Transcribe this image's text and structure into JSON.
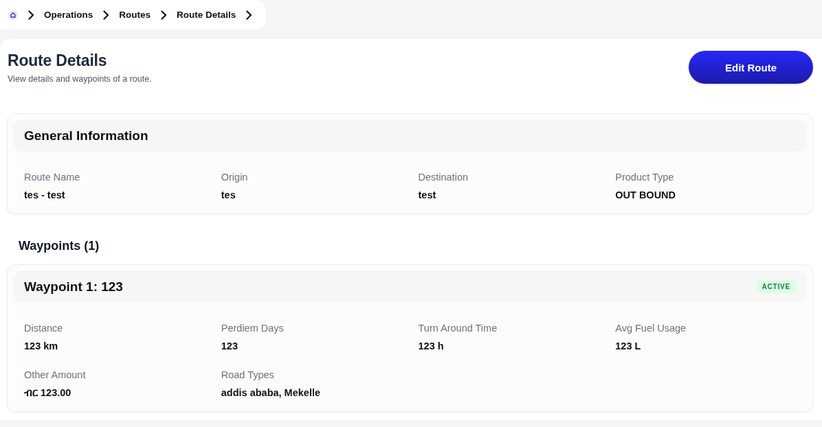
{
  "breadcrumb": [
    "Operations",
    "Routes",
    "Route Details"
  ],
  "header": {
    "title": "Route Details",
    "subtitle": "View details and waypoints of a route.",
    "action": "Edit Route"
  },
  "general_information": {
    "title": "General Information",
    "fields": [
      {
        "label": "Route Name",
        "value": "tes - test"
      },
      {
        "label": "Origin",
        "value": "tes"
      },
      {
        "label": "Destination",
        "value": "test"
      },
      {
        "label": "Product Type",
        "value": "OUT BOUND"
      }
    ]
  },
  "waypoints": {
    "title": "Waypoints (1)",
    "items": [
      {
        "title": "Waypoint 1: 123",
        "status": {
          "label": "ACTIVE",
          "kind": "active"
        },
        "fields": [
          {
            "label": "Distance",
            "value": "123 km"
          },
          {
            "label": "Perdiem Days",
            "value": "123"
          },
          {
            "label": "Turn Around Time",
            "value": "123 h"
          },
          {
            "label": "Avg Fuel Usage",
            "value": "123 L"
          },
          {
            "label": "Other Amount",
            "value": "ብር 123.00"
          },
          {
            "label": "Road Types",
            "value": "addis ababa, Mekelle"
          }
        ]
      }
    ]
  }
}
